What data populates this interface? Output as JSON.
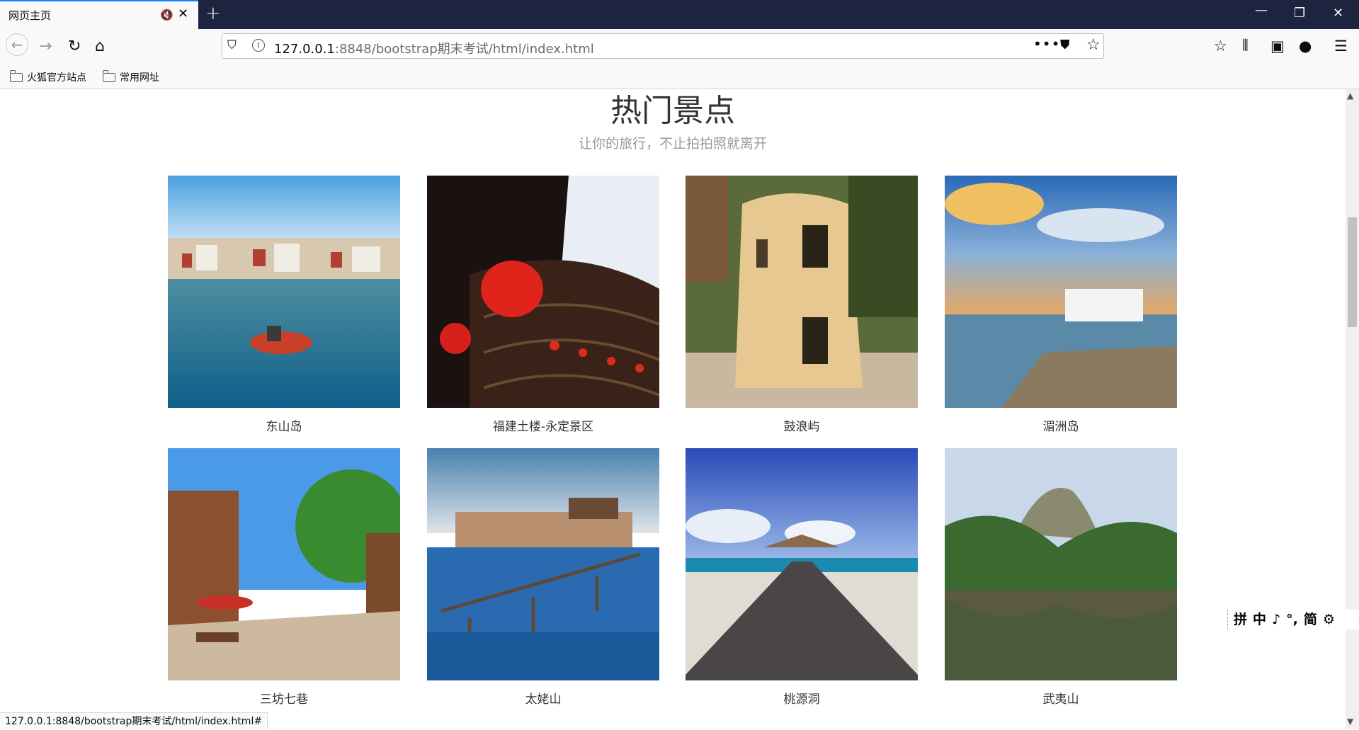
{
  "browser": {
    "tab_title": "网页主页",
    "mute_icon": "🔇",
    "close_glyph": "✕",
    "newtab_glyph": "+",
    "url_host": "127.0.0.1",
    "url_rest": ":8848/bootstrap期末考试/html/index.html",
    "url_dots": "•••",
    "bookmarks": [
      "火狐官方站点",
      "常用网址"
    ],
    "status_url": "127.0.0.1:8848/bootstrap期末考试/html/index.html#"
  },
  "page": {
    "title": "热门景点",
    "subtitle": "让你的旅行，不止拍拍照就离开",
    "attractions": [
      {
        "name": "东山岛"
      },
      {
        "name": "福建土楼-永定景区"
      },
      {
        "name": "鼓浪屿"
      },
      {
        "name": "湄洲岛"
      },
      {
        "name": "三坊七巷"
      },
      {
        "name": "太姥山"
      },
      {
        "name": "桃源洞"
      },
      {
        "name": "武夷山"
      }
    ]
  },
  "ime": {
    "items": [
      "拼",
      "中",
      "♪",
      "°,",
      "简",
      "⚙"
    ]
  }
}
